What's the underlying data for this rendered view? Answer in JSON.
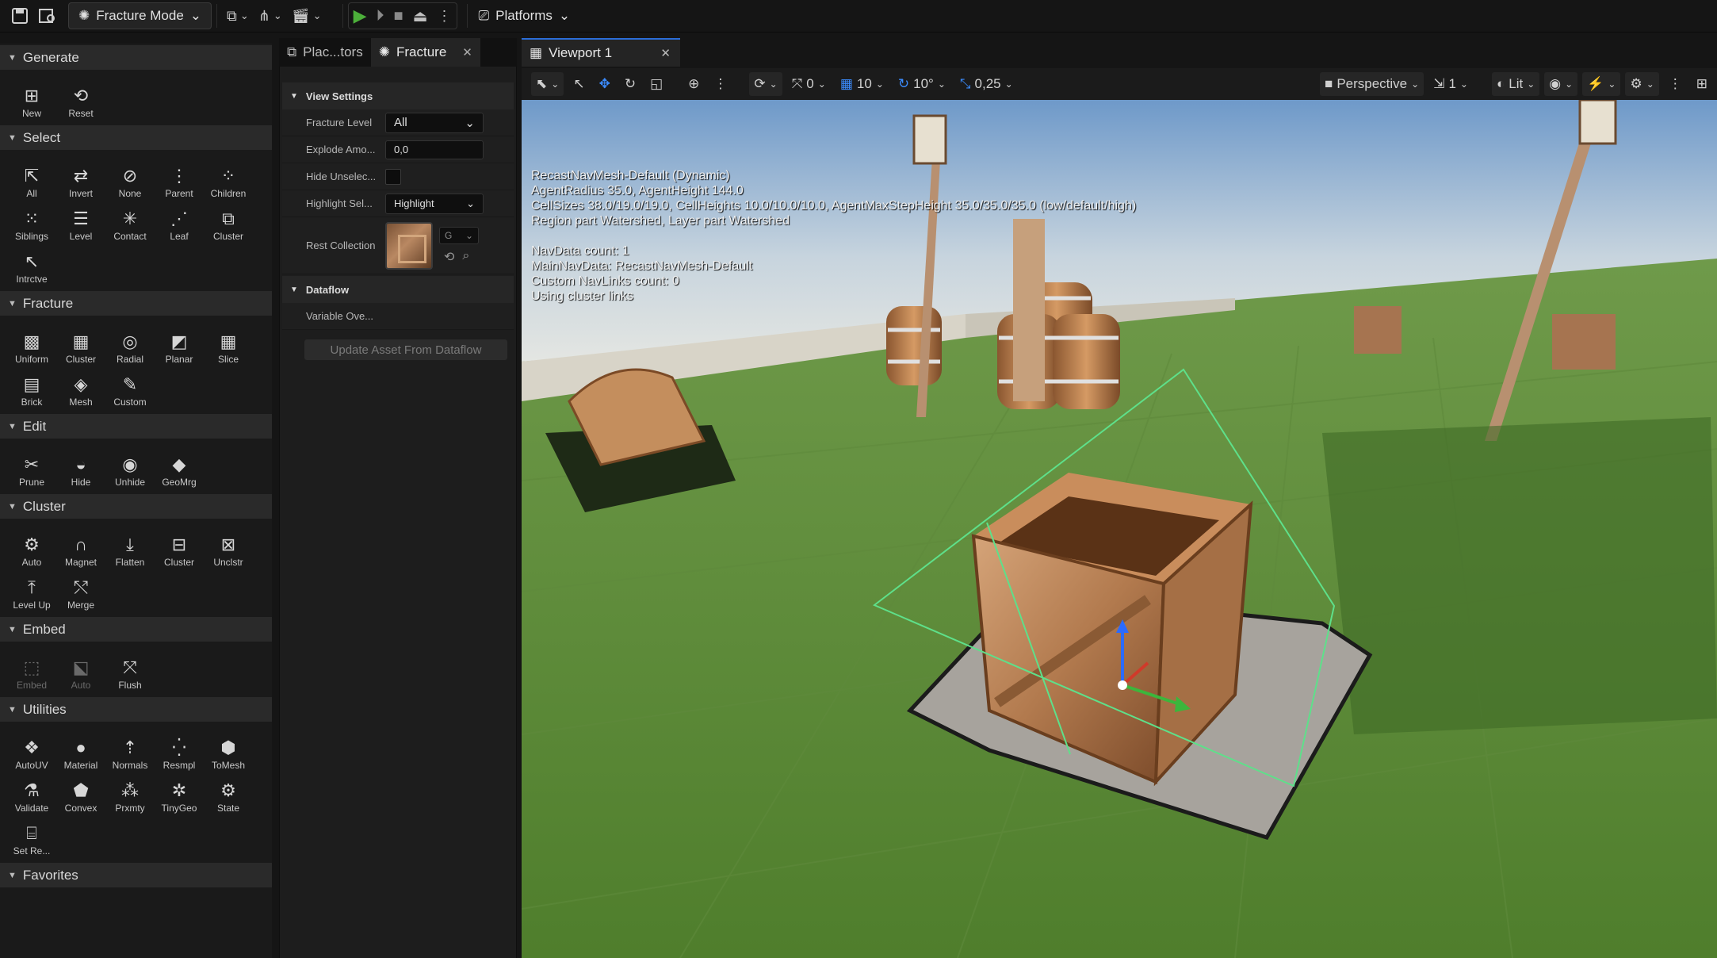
{
  "topbar": {
    "mode_label": "Fracture Mode",
    "platforms_label": "Platforms"
  },
  "palette": {
    "sections": [
      {
        "title": "Generate",
        "tools": [
          {
            "label": "New",
            "icon": "plus-box-icon",
            "glyph": "⊞"
          },
          {
            "label": "Reset",
            "icon": "reset-icon",
            "glyph": "⟲"
          }
        ]
      },
      {
        "title": "Select",
        "tools": [
          {
            "label": "All",
            "icon": "select-all-icon",
            "glyph": "⇱"
          },
          {
            "label": "Invert",
            "icon": "invert-icon",
            "glyph": "⇄"
          },
          {
            "label": "None",
            "icon": "select-none-icon",
            "glyph": "⊘"
          },
          {
            "label": "Parent",
            "icon": "parent-icon",
            "glyph": "⋮"
          },
          {
            "label": "Children",
            "icon": "children-icon",
            "glyph": "⁘"
          },
          {
            "label": "Siblings",
            "icon": "siblings-icon",
            "glyph": "⁙"
          },
          {
            "label": "Level",
            "icon": "level-icon",
            "glyph": "☰"
          },
          {
            "label": "Contact",
            "icon": "contact-icon",
            "glyph": "✳"
          },
          {
            "label": "Leaf",
            "icon": "leaf-icon",
            "glyph": "⋰"
          },
          {
            "label": "Cluster",
            "icon": "cluster-icon",
            "glyph": "⧉"
          },
          {
            "label": "Intrctve",
            "icon": "interactive-icon",
            "glyph": "↖"
          }
        ]
      },
      {
        "title": "Fracture",
        "tools": [
          {
            "label": "Uniform",
            "icon": "uniform-icon",
            "glyph": "▩"
          },
          {
            "label": "Cluster",
            "icon": "cluster-fracture-icon",
            "glyph": "▦"
          },
          {
            "label": "Radial",
            "icon": "radial-icon",
            "glyph": "◎"
          },
          {
            "label": "Planar",
            "icon": "planar-icon",
            "glyph": "◩"
          },
          {
            "label": "Slice",
            "icon": "slice-icon",
            "glyph": "▦"
          },
          {
            "label": "Brick",
            "icon": "brick-icon",
            "glyph": "▤"
          },
          {
            "label": "Mesh",
            "icon": "mesh-icon",
            "glyph": "◈"
          },
          {
            "label": "Custom",
            "icon": "custom-icon",
            "glyph": "✎"
          }
        ]
      },
      {
        "title": "Edit",
        "tools": [
          {
            "label": "Prune",
            "icon": "prune-icon",
            "glyph": "✂"
          },
          {
            "label": "Hide",
            "icon": "hide-icon",
            "glyph": "◒"
          },
          {
            "label": "Unhide",
            "icon": "unhide-icon",
            "glyph": "◉"
          },
          {
            "label": "GeoMrg",
            "icon": "geo-merge-icon",
            "glyph": "◆"
          }
        ]
      },
      {
        "title": "Cluster",
        "tools": [
          {
            "label": "Auto",
            "icon": "auto-cluster-icon",
            "glyph": "⚙"
          },
          {
            "label": "Magnet",
            "icon": "magnet-icon",
            "glyph": "∩"
          },
          {
            "label": "Flatten",
            "icon": "flatten-icon",
            "glyph": "⤓"
          },
          {
            "label": "Cluster",
            "icon": "cluster-merge-icon",
            "glyph": "⊟"
          },
          {
            "label": "Unclstr",
            "icon": "uncluster-icon",
            "glyph": "⊠"
          },
          {
            "label": "Level Up",
            "icon": "level-up-icon",
            "glyph": "⤒"
          },
          {
            "label": "Merge",
            "icon": "merge-icon",
            "glyph": "⤲"
          }
        ]
      },
      {
        "title": "Embed",
        "tools": [
          {
            "label": "Embed",
            "icon": "embed-icon",
            "glyph": "⬚",
            "disabled": true
          },
          {
            "label": "Auto",
            "icon": "auto-embed-icon",
            "glyph": "⬕",
            "disabled": true
          },
          {
            "label": "Flush",
            "icon": "flush-icon",
            "glyph": "⤧"
          }
        ]
      },
      {
        "title": "Utilities",
        "tools": [
          {
            "label": "AutoUV",
            "icon": "auto-uv-icon",
            "glyph": "❖"
          },
          {
            "label": "Material",
            "icon": "material-icon",
            "glyph": "●"
          },
          {
            "label": "Normals",
            "icon": "normals-icon",
            "glyph": "⇡"
          },
          {
            "label": "Resmpl",
            "icon": "resample-icon",
            "glyph": "⁛"
          },
          {
            "label": "ToMesh",
            "icon": "to-mesh-icon",
            "glyph": "⬢"
          },
          {
            "label": "Validate",
            "icon": "validate-icon",
            "glyph": "⚗"
          },
          {
            "label": "Convex",
            "icon": "convex-icon",
            "glyph": "⬟"
          },
          {
            "label": "Prxmty",
            "icon": "proximity-icon",
            "glyph": "⁂"
          },
          {
            "label": "TinyGeo",
            "icon": "tiny-geo-icon",
            "glyph": "✲"
          },
          {
            "label": "State",
            "icon": "state-icon",
            "glyph": "⚙"
          },
          {
            "label": "Set Re...",
            "icon": "set-rest-icon",
            "glyph": "⌸"
          }
        ]
      },
      {
        "title": "Favorites",
        "tools": []
      }
    ]
  },
  "midpanel": {
    "tabs": [
      {
        "label": "Plac...tors",
        "icon": "place-actors-icon"
      },
      {
        "label": "Fracture",
        "icon": "fracture-tab-icon"
      }
    ],
    "view_settings": {
      "title": "View Settings",
      "fracture_level_label": "Fracture Level",
      "fracture_level_value": "All",
      "explode_label": "Explode Amo...",
      "explode_value": "0,0",
      "hide_label": "Hide Unselec...",
      "highlight_label": "Highlight Sel...",
      "highlight_value": "Highlight",
      "rest_label": "Rest Collection",
      "rest_combo": "G"
    },
    "dataflow": {
      "title": "Dataflow",
      "variable_label": "Variable Ove...",
      "update_button": "Update Asset From Dataflow"
    }
  },
  "viewport": {
    "tab_label": "Viewport 1",
    "toolbar": {
      "rotate_snap": "0",
      "grid_snap": "10",
      "angle_snap": "10°",
      "scale_snap": "0,25",
      "perspective": "Perspective",
      "camera_speed": "1",
      "view_mode": "Lit"
    },
    "overlay_lines": [
      "RecastNavMesh-Default (Dynamic)",
      "AgentRadius 35.0, AgentHeight 144.0",
      "CellSizes 38.0/19.0/19.0, CellHeights 10.0/10.0/10.0, AgentMaxStepHeight 35.0/35.0/35.0 (low/default/high)",
      "Region part Watershed, Layer part Watershed",
      "",
      "NavData count: 1",
      "MainNavData: RecastNavMesh-Default",
      "Custom NavLinks count: 0",
      "Using cluster links"
    ]
  }
}
